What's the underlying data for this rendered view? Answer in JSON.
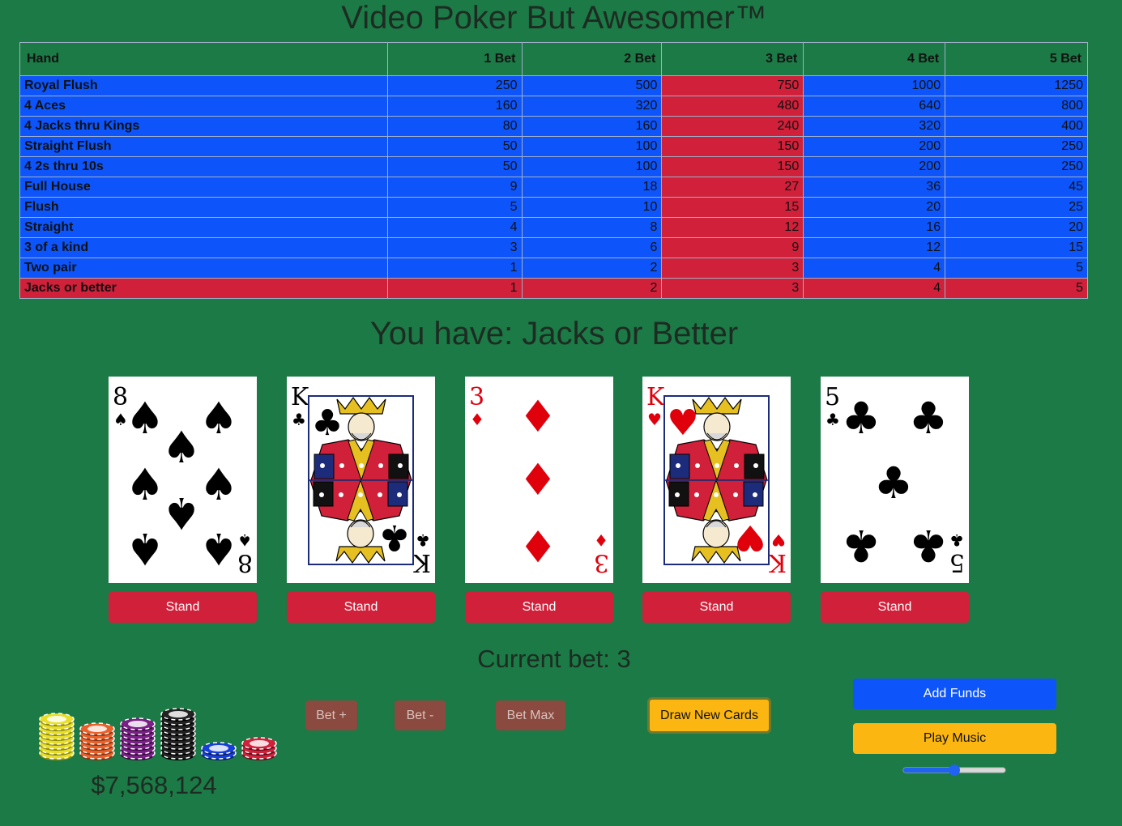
{
  "title": "Video Poker But Awesomer™",
  "paytable": {
    "headers": [
      "Hand",
      "1 Bet",
      "2 Bet",
      "3 Bet",
      "4 Bet",
      "5 Bet"
    ],
    "highlight_column": 3,
    "highlight_row": 10,
    "rows": [
      {
        "hand": "Royal Flush",
        "payouts": [
          "250",
          "500",
          "750",
          "1000",
          "1250"
        ]
      },
      {
        "hand": "4 Aces",
        "payouts": [
          "160",
          "320",
          "480",
          "640",
          "800"
        ]
      },
      {
        "hand": "4 Jacks thru Kings",
        "payouts": [
          "80",
          "160",
          "240",
          "320",
          "400"
        ]
      },
      {
        "hand": "Straight Flush",
        "payouts": [
          "50",
          "100",
          "150",
          "200",
          "250"
        ]
      },
      {
        "hand": "4 2s thru 10s",
        "payouts": [
          "50",
          "100",
          "150",
          "200",
          "250"
        ]
      },
      {
        "hand": "Full House",
        "payouts": [
          "9",
          "18",
          "27",
          "36",
          "45"
        ]
      },
      {
        "hand": "Flush",
        "payouts": [
          "5",
          "10",
          "15",
          "20",
          "25"
        ]
      },
      {
        "hand": "Straight",
        "payouts": [
          "4",
          "8",
          "12",
          "16",
          "20"
        ]
      },
      {
        "hand": "3 of a kind",
        "payouts": [
          "3",
          "6",
          "9",
          "12",
          "15"
        ]
      },
      {
        "hand": "Two pair",
        "payouts": [
          "1",
          "2",
          "3",
          "4",
          "5"
        ]
      },
      {
        "hand": "Jacks or better",
        "payouts": [
          "1",
          "2",
          "3",
          "4",
          "5"
        ]
      }
    ]
  },
  "result": "You have: Jacks or Better",
  "cards": [
    {
      "rank": "8",
      "suit": "spades",
      "stand_label": "Stand"
    },
    {
      "rank": "K",
      "suit": "clubs",
      "stand_label": "Stand"
    },
    {
      "rank": "3",
      "suit": "diamonds",
      "stand_label": "Stand"
    },
    {
      "rank": "K",
      "suit": "hearts",
      "stand_label": "Stand"
    },
    {
      "rank": "5",
      "suit": "clubs",
      "stand_label": "Stand"
    }
  ],
  "current_bet": "Current bet: 3",
  "controls": {
    "bet_plus": "Bet +",
    "bet_minus": "Bet -",
    "bet_max": "Bet Max",
    "draw": "Draw New Cards",
    "add_funds": "Add Funds",
    "play_music": "Play Music",
    "volume": 0.5
  },
  "funds": "$7,568,124",
  "colors": {
    "felt": "#1b7a45",
    "table_blue": "#0d55fa",
    "table_red": "#d0203a",
    "stand_red": "#d0203a",
    "bet_brown": "#8a4a3f",
    "draw_yellow": "#fbb612",
    "card_red": "#e0000c",
    "card_black": "#000000"
  }
}
